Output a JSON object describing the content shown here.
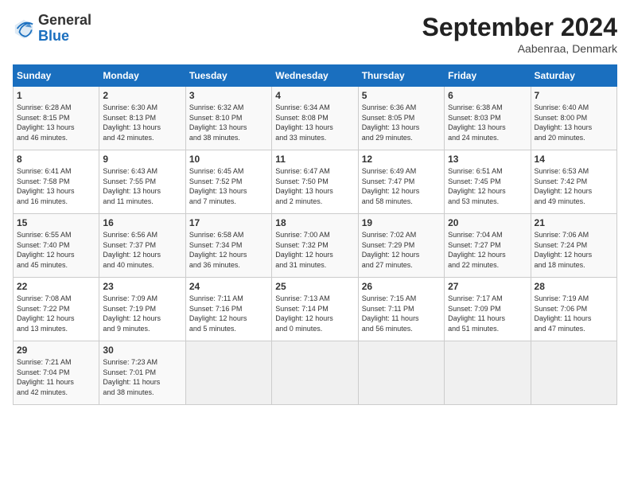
{
  "logo": {
    "general": "General",
    "blue": "Blue"
  },
  "title": "September 2024",
  "location": "Aabenraa, Denmark",
  "days_header": [
    "Sunday",
    "Monday",
    "Tuesday",
    "Wednesday",
    "Thursday",
    "Friday",
    "Saturday"
  ],
  "weeks": [
    [
      {
        "day": "1",
        "lines": [
          "Sunrise: 6:28 AM",
          "Sunset: 8:15 PM",
          "Daylight: 13 hours",
          "and 46 minutes."
        ]
      },
      {
        "day": "2",
        "lines": [
          "Sunrise: 6:30 AM",
          "Sunset: 8:13 PM",
          "Daylight: 13 hours",
          "and 42 minutes."
        ]
      },
      {
        "day": "3",
        "lines": [
          "Sunrise: 6:32 AM",
          "Sunset: 8:10 PM",
          "Daylight: 13 hours",
          "and 38 minutes."
        ]
      },
      {
        "day": "4",
        "lines": [
          "Sunrise: 6:34 AM",
          "Sunset: 8:08 PM",
          "Daylight: 13 hours",
          "and 33 minutes."
        ]
      },
      {
        "day": "5",
        "lines": [
          "Sunrise: 6:36 AM",
          "Sunset: 8:05 PM",
          "Daylight: 13 hours",
          "and 29 minutes."
        ]
      },
      {
        "day": "6",
        "lines": [
          "Sunrise: 6:38 AM",
          "Sunset: 8:03 PM",
          "Daylight: 13 hours",
          "and 24 minutes."
        ]
      },
      {
        "day": "7",
        "lines": [
          "Sunrise: 6:40 AM",
          "Sunset: 8:00 PM",
          "Daylight: 13 hours",
          "and 20 minutes."
        ]
      }
    ],
    [
      {
        "day": "8",
        "lines": [
          "Sunrise: 6:41 AM",
          "Sunset: 7:58 PM",
          "Daylight: 13 hours",
          "and 16 minutes."
        ]
      },
      {
        "day": "9",
        "lines": [
          "Sunrise: 6:43 AM",
          "Sunset: 7:55 PM",
          "Daylight: 13 hours",
          "and 11 minutes."
        ]
      },
      {
        "day": "10",
        "lines": [
          "Sunrise: 6:45 AM",
          "Sunset: 7:52 PM",
          "Daylight: 13 hours",
          "and 7 minutes."
        ]
      },
      {
        "day": "11",
        "lines": [
          "Sunrise: 6:47 AM",
          "Sunset: 7:50 PM",
          "Daylight: 13 hours",
          "and 2 minutes."
        ]
      },
      {
        "day": "12",
        "lines": [
          "Sunrise: 6:49 AM",
          "Sunset: 7:47 PM",
          "Daylight: 12 hours",
          "and 58 minutes."
        ]
      },
      {
        "day": "13",
        "lines": [
          "Sunrise: 6:51 AM",
          "Sunset: 7:45 PM",
          "Daylight: 12 hours",
          "and 53 minutes."
        ]
      },
      {
        "day": "14",
        "lines": [
          "Sunrise: 6:53 AM",
          "Sunset: 7:42 PM",
          "Daylight: 12 hours",
          "and 49 minutes."
        ]
      }
    ],
    [
      {
        "day": "15",
        "lines": [
          "Sunrise: 6:55 AM",
          "Sunset: 7:40 PM",
          "Daylight: 12 hours",
          "and 45 minutes."
        ]
      },
      {
        "day": "16",
        "lines": [
          "Sunrise: 6:56 AM",
          "Sunset: 7:37 PM",
          "Daylight: 12 hours",
          "and 40 minutes."
        ]
      },
      {
        "day": "17",
        "lines": [
          "Sunrise: 6:58 AM",
          "Sunset: 7:34 PM",
          "Daylight: 12 hours",
          "and 36 minutes."
        ]
      },
      {
        "day": "18",
        "lines": [
          "Sunrise: 7:00 AM",
          "Sunset: 7:32 PM",
          "Daylight: 12 hours",
          "and 31 minutes."
        ]
      },
      {
        "day": "19",
        "lines": [
          "Sunrise: 7:02 AM",
          "Sunset: 7:29 PM",
          "Daylight: 12 hours",
          "and 27 minutes."
        ]
      },
      {
        "day": "20",
        "lines": [
          "Sunrise: 7:04 AM",
          "Sunset: 7:27 PM",
          "Daylight: 12 hours",
          "and 22 minutes."
        ]
      },
      {
        "day": "21",
        "lines": [
          "Sunrise: 7:06 AM",
          "Sunset: 7:24 PM",
          "Daylight: 12 hours",
          "and 18 minutes."
        ]
      }
    ],
    [
      {
        "day": "22",
        "lines": [
          "Sunrise: 7:08 AM",
          "Sunset: 7:22 PM",
          "Daylight: 12 hours",
          "and 13 minutes."
        ]
      },
      {
        "day": "23",
        "lines": [
          "Sunrise: 7:09 AM",
          "Sunset: 7:19 PM",
          "Daylight: 12 hours",
          "and 9 minutes."
        ]
      },
      {
        "day": "24",
        "lines": [
          "Sunrise: 7:11 AM",
          "Sunset: 7:16 PM",
          "Daylight: 12 hours",
          "and 5 minutes."
        ]
      },
      {
        "day": "25",
        "lines": [
          "Sunrise: 7:13 AM",
          "Sunset: 7:14 PM",
          "Daylight: 12 hours",
          "and 0 minutes."
        ]
      },
      {
        "day": "26",
        "lines": [
          "Sunrise: 7:15 AM",
          "Sunset: 7:11 PM",
          "Daylight: 11 hours",
          "and 56 minutes."
        ]
      },
      {
        "day": "27",
        "lines": [
          "Sunrise: 7:17 AM",
          "Sunset: 7:09 PM",
          "Daylight: 11 hours",
          "and 51 minutes."
        ]
      },
      {
        "day": "28",
        "lines": [
          "Sunrise: 7:19 AM",
          "Sunset: 7:06 PM",
          "Daylight: 11 hours",
          "and 47 minutes."
        ]
      }
    ],
    [
      {
        "day": "29",
        "lines": [
          "Sunrise: 7:21 AM",
          "Sunset: 7:04 PM",
          "Daylight: 11 hours",
          "and 42 minutes."
        ]
      },
      {
        "day": "30",
        "lines": [
          "Sunrise: 7:23 AM",
          "Sunset: 7:01 PM",
          "Daylight: 11 hours",
          "and 38 minutes."
        ]
      },
      {
        "day": "",
        "lines": []
      },
      {
        "day": "",
        "lines": []
      },
      {
        "day": "",
        "lines": []
      },
      {
        "day": "",
        "lines": []
      },
      {
        "day": "",
        "lines": []
      }
    ]
  ]
}
